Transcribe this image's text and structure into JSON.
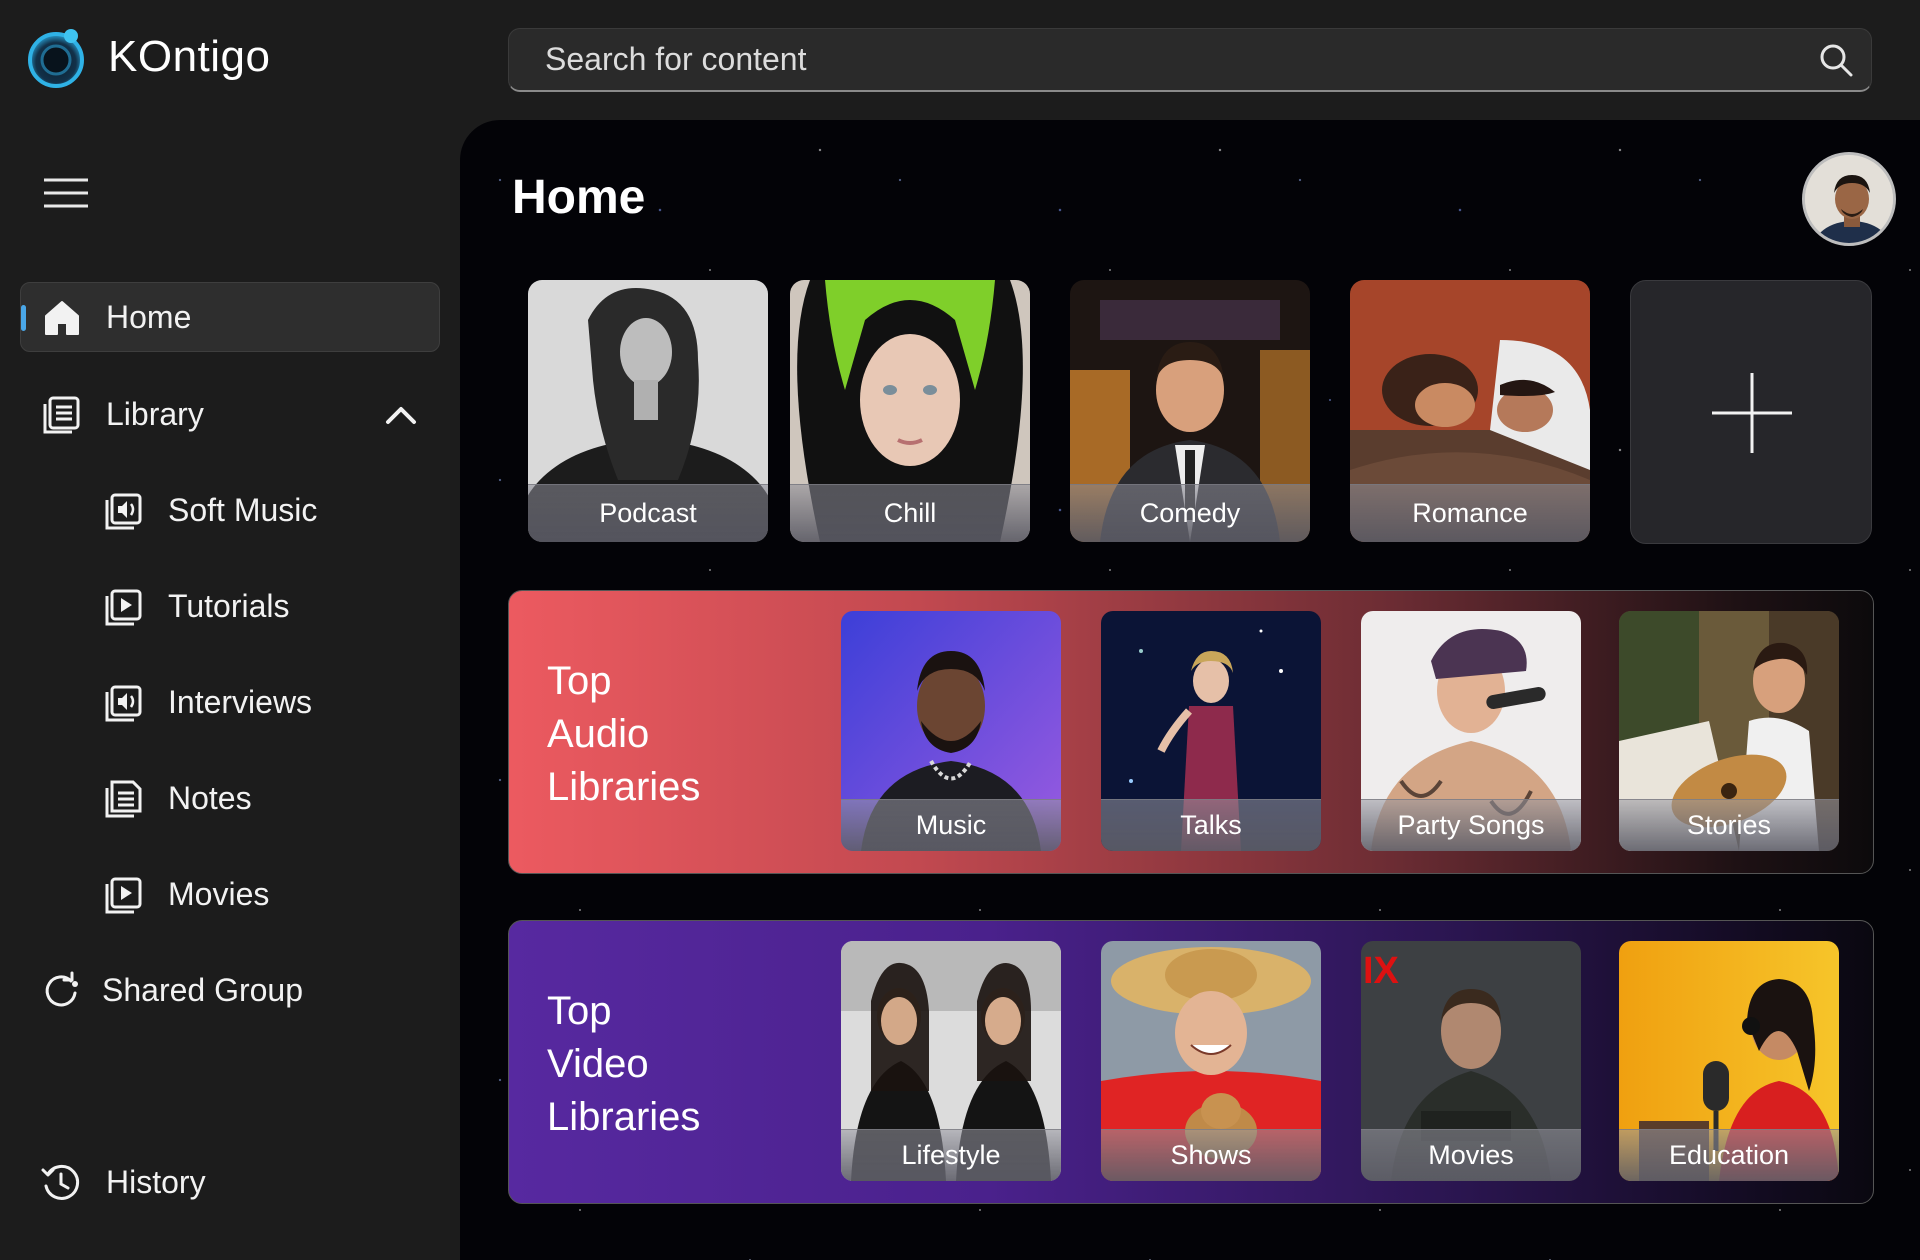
{
  "app": {
    "name": "KOntigo",
    "accent": "#4aa7e8"
  },
  "search": {
    "placeholder": "Search for content",
    "icon": "search-icon"
  },
  "sidebar": {
    "menu_icon": "hamburger-icon",
    "items": [
      {
        "label": "Home",
        "icon": "home-icon",
        "active": true
      },
      {
        "label": "Library",
        "icon": "library-icon",
        "expanded": true
      },
      {
        "label": "Soft Music",
        "icon": "audio-library-icon"
      },
      {
        "label": "Tutorials",
        "icon": "video-library-icon"
      },
      {
        "label": "Interviews",
        "icon": "audio-library-icon"
      },
      {
        "label": "Notes",
        "icon": "notes-icon"
      },
      {
        "label": "Movies",
        "icon": "video-library-icon"
      },
      {
        "label": "Shared Group",
        "icon": "shared-sync-icon"
      },
      {
        "label": "History",
        "icon": "history-icon"
      }
    ]
  },
  "main": {
    "title": "Home",
    "categories": [
      {
        "label": "Podcast"
      },
      {
        "label": "Chill"
      },
      {
        "label": "Comedy"
      },
      {
        "label": "Romance"
      }
    ],
    "add_tile_icon": "plus-icon",
    "audio_libraries": {
      "title_lines": [
        "Top",
        "Audio",
        "Libraries"
      ],
      "items": [
        {
          "label": "Music"
        },
        {
          "label": "Talks"
        },
        {
          "label": "Party Songs"
        },
        {
          "label": "Stories"
        }
      ]
    },
    "video_libraries": {
      "title_lines": [
        "Top",
        "Video",
        "Libraries"
      ],
      "items": [
        {
          "label": "Lifestyle"
        },
        {
          "label": "Shows"
        },
        {
          "label": "Movies"
        },
        {
          "label": "Education"
        }
      ]
    }
  }
}
